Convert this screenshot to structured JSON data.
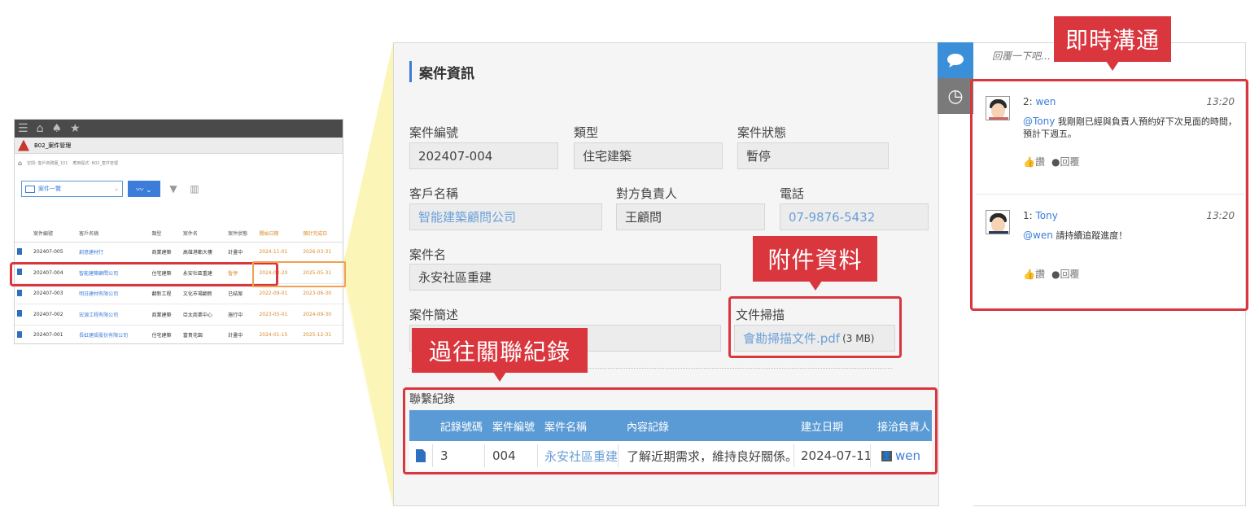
{
  "mini_app": {
    "module_title": "B02_案件管理",
    "breadcrumb": [
      "空間: 客戶商務圈_101",
      "應用程式: B02_案件管理"
    ],
    "view_select": "案件一覽",
    "columns": [
      "案件編號",
      "客戶名稱",
      "類型",
      "案件名",
      "案件狀態",
      "開始日期",
      "預計完成日"
    ],
    "rows": [
      {
        "id": "202407-005",
        "client": "創意建材行",
        "type": "商業建築",
        "name": "高雄港都大樓",
        "status": "計畫中",
        "start": "2024-11-01",
        "end": "2026-03-31"
      },
      {
        "id": "202407-004",
        "client": "智能建築顧問公司",
        "type": "住宅建築",
        "name": "永安社區重建",
        "status": "暫停",
        "start": "2024-02-20",
        "end": "2025-05-31"
      },
      {
        "id": "202407-003",
        "client": "明日建材有限公司",
        "type": "翻新工程",
        "name": "文化市場翻新",
        "status": "已結案",
        "start": "2022-09-01",
        "end": "2023-06-30"
      },
      {
        "id": "202407-002",
        "client": "宏源工程有限公司",
        "type": "商業建築",
        "name": "亞太商業中心",
        "status": "施行中",
        "start": "2023-05-01",
        "end": "2024-09-30"
      },
      {
        "id": "202407-001",
        "client": "長虹建設股份有限公司",
        "type": "住宅建築",
        "name": "富貴花園",
        "status": "計畫中",
        "start": "2024-01-15",
        "end": "2025-12-31"
      }
    ]
  },
  "form": {
    "title": "案件資訊",
    "case_no_label": "案件編號",
    "case_no": "202407-004",
    "type_label": "類型",
    "type": "住宅建築",
    "status_label": "案件狀態",
    "status": "暫停",
    "client_label": "客戶名稱",
    "client": "智能建築顧問公司",
    "contact_label": "對方負責人",
    "contact": "王顧問",
    "phone_label": "電話",
    "phone": "07-9876-5432",
    "case_name_label": "案件名",
    "case_name": "永安社區重建",
    "summary_label": "案件簡述",
    "attachment_label": "文件掃描",
    "attachment_file": "會勘掃描文件.pdf",
    "attachment_size": "(3 MB)"
  },
  "records": {
    "title": "聯繫紀錄",
    "headers": [
      "記錄號碼",
      "案件編號",
      "案件名稱",
      "內容記錄",
      "建立日期",
      "接洽負責人"
    ],
    "row": {
      "no": "3",
      "case_no": "004",
      "case_name": "永安社區重建",
      "content": "了解近期需求，維持良好關係。",
      "date": "2024-07-11",
      "owner": "wen"
    }
  },
  "callouts": {
    "chat": "即時溝通",
    "attachment": "附件資料",
    "history": "過往關聯紀錄"
  },
  "chat": {
    "reply_placeholder": "回覆一下吧…",
    "messages": [
      {
        "index": "2:",
        "user": "wen",
        "time": "13:20",
        "mention": "@Tony",
        "text": "我剛剛已經與負責人預約好下次見面的時間，預計下週五。",
        "like": "讚",
        "reply": "回覆"
      },
      {
        "index": "1:",
        "user": "Tony",
        "time": "13:20",
        "mention": "@wen",
        "text": "請持續追蹤進度！",
        "like": "讚",
        "reply": "回覆"
      }
    ]
  },
  "colors": {
    "accent": "#3b7dd8",
    "callout": "#d9363e",
    "highlight_cone": "#faf39a",
    "table_header": "#5b9bd5"
  }
}
